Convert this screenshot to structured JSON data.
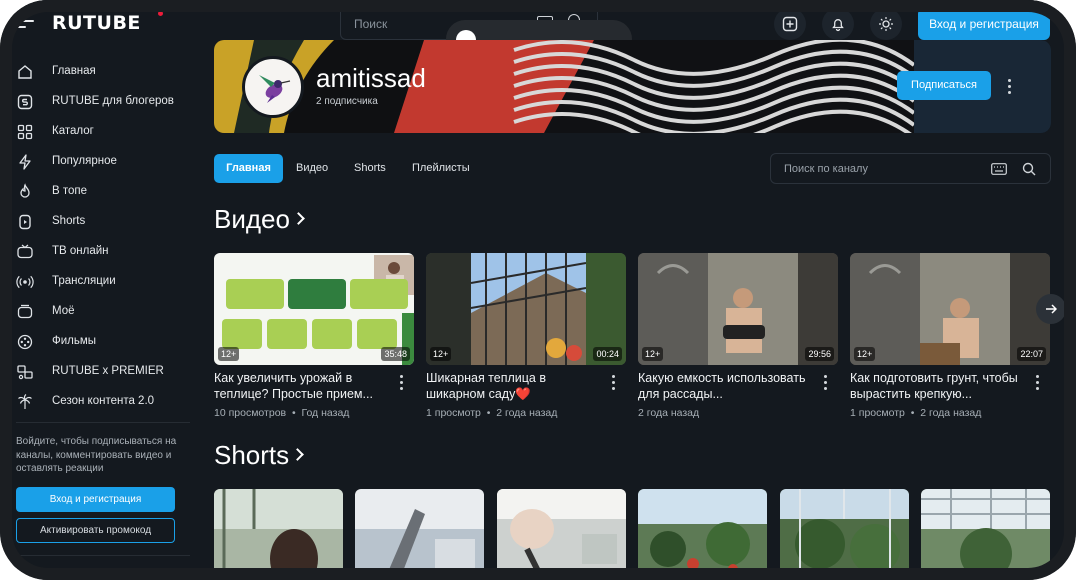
{
  "brand": {
    "logo_text": "RUTUBE",
    "accent": "#1aa0e8",
    "logo_dot": "#ed1c3a"
  },
  "topbar": {
    "search_placeholder": "Поиск",
    "login_label": "Вход и регистрация",
    "icons": [
      "menu-icon",
      "keyboard-icon",
      "search-icon",
      "upload-icon",
      "bell-icon",
      "sun-icon"
    ]
  },
  "sidebar": {
    "items": [
      {
        "label": "Главная",
        "icon": "home-icon"
      },
      {
        "label": "RUTUBE для блогеров",
        "icon": "studio-icon"
      },
      {
        "label": "Каталог",
        "icon": "catalog-icon"
      },
      {
        "label": "Популярное",
        "icon": "lightning-icon"
      },
      {
        "label": "В топе",
        "icon": "flame-icon"
      },
      {
        "label": "Shorts",
        "icon": "shorts-icon"
      },
      {
        "label": "ТВ онлайн",
        "icon": "tv-icon"
      },
      {
        "label": "Трансляции",
        "icon": "broadcast-icon"
      },
      {
        "label": "Моё",
        "icon": "my-icon"
      },
      {
        "label": "Фильмы",
        "icon": "film-icon"
      },
      {
        "label": "RUTUBE x PREMIER",
        "icon": "premier-icon"
      },
      {
        "label": "Сезон контента 2.0",
        "icon": "palm-icon"
      }
    ],
    "prompt_text": "Войдите, чтобы подписываться на каналы, комментировать видео и оставлять реакции",
    "login_label": "Вход и регистрация",
    "promo_label": "Активировать промокод"
  },
  "channel": {
    "name": "amitissad",
    "subscribers": "2 подписчика",
    "subscribe_label": "Подписаться",
    "tabs": [
      {
        "label": "Главная",
        "active": true
      },
      {
        "label": "Видео",
        "active": false
      },
      {
        "label": "Shorts",
        "active": false
      },
      {
        "label": "Плейлисты",
        "active": false
      }
    ],
    "search_placeholder": "Поиск по каналу"
  },
  "videos_section": {
    "title": "Видео",
    "items": [
      {
        "title": "Как увеличить урожай в теплице? Простые прием...",
        "age_rating": "12+",
        "duration": "35:48",
        "views": "10 просмотров",
        "date": "Год назад"
      },
      {
        "title": "Шикарная теплица в шикарном саду❤️",
        "age_rating": "12+",
        "duration": "00:24",
        "views": "1 просмотр",
        "date": "2 года назад"
      },
      {
        "title": "Какую емкость использовать для рассады...",
        "age_rating": "12+",
        "duration": "29:56",
        "views": "",
        "date": "2 года назад"
      },
      {
        "title": "Как подготовить грунт, чтобы вырастить крепкую...",
        "age_rating": "12+",
        "duration": "22:07",
        "views": "1 просмотр",
        "date": "2 года назад"
      }
    ]
  },
  "shorts_section": {
    "title": "Shorts",
    "count_visible": 6
  }
}
